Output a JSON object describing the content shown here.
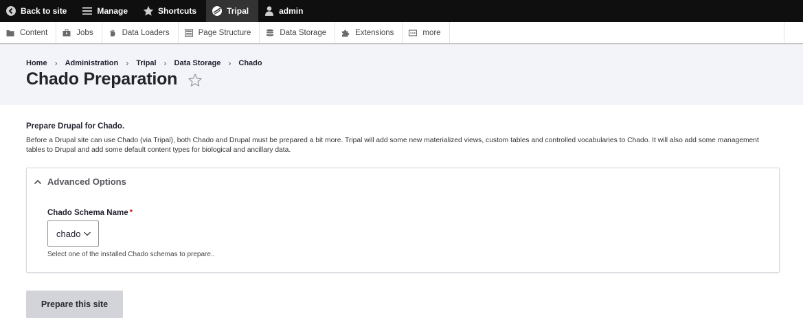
{
  "toolbar": {
    "items": [
      {
        "label": "Back to site",
        "icon": "back-circle-icon"
      },
      {
        "label": "Manage",
        "icon": "hamburger-icon"
      },
      {
        "label": "Shortcuts",
        "icon": "star-filled-icon"
      },
      {
        "label": "Tripal",
        "icon": "tripal-logo-icon",
        "active": true
      },
      {
        "label": "admin",
        "icon": "user-icon"
      }
    ]
  },
  "tray": {
    "items": [
      {
        "label": "Content",
        "icon": "folder-icon"
      },
      {
        "label": "Jobs",
        "icon": "briefcase-icon"
      },
      {
        "label": "Data Loaders",
        "icon": "hand-icon"
      },
      {
        "label": "Page Structure",
        "icon": "layout-icon"
      },
      {
        "label": "Data Storage",
        "icon": "database-icon"
      },
      {
        "label": "Extensions",
        "icon": "puzzle-icon"
      },
      {
        "label": "more",
        "icon": "ellipsis-icon"
      }
    ]
  },
  "breadcrumb": [
    "Home",
    "Administration",
    "Tripal",
    "Data Storage",
    "Chado"
  ],
  "page": {
    "title": "Chado Preparation"
  },
  "content": {
    "heading": "Prepare Drupal for Chado.",
    "description": "Before a Drupal site can use Chado (via Tripal), both Chado and Drupal must be prepared a bit more. Tripal will add some new materialized views, custom tables and controlled vocabularies to Chado. It will also add some management tables to Drupal and add some default content types for biological and ancillary data.",
    "advanced": {
      "summary": "Advanced Options",
      "field_label": "Chado Schema Name",
      "required_mark": "*",
      "selected_value": "chado",
      "field_description": "Select one of the installed Chado schemas to prepare.."
    },
    "submit_label": "Prepare this site"
  },
  "colors": {
    "toolbar_bg": "#0f0f0f",
    "header_bg": "#f3f4f9",
    "required": "#d72222",
    "button_bg": "#d3d4d9"
  }
}
